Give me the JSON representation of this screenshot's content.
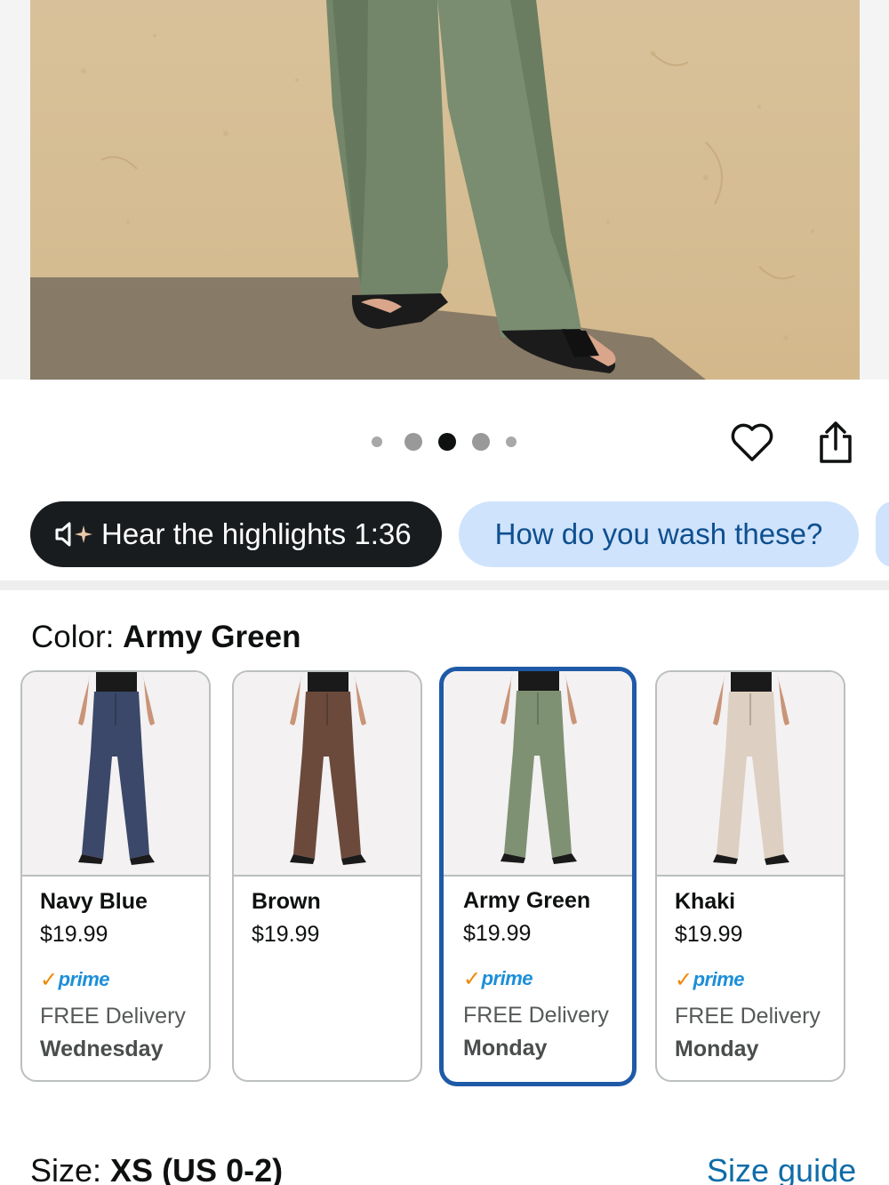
{
  "hero": {
    "image": "product-photo-model-wearing-army-green-wide-leg-pants-on-sand"
  },
  "carousel": {
    "total_dots": 5,
    "active_index": 2
  },
  "actions": {
    "favorite_icon": "heart-icon",
    "share_icon": "share-icon"
  },
  "chips": {
    "audio_label": "Hear the highlights 1:36",
    "audio_icon": "speaker-sparkle-icon",
    "question_label": "How do you wash these?"
  },
  "color": {
    "prefix": "Color: ",
    "selected": "Army Green"
  },
  "swatches": [
    {
      "name": "Navy Blue",
      "price": "$19.99",
      "prime": "prime",
      "delivery": "FREE Delivery",
      "day": "Wednesday",
      "color": "#3b4869"
    },
    {
      "name": "Brown",
      "price": "$19.99",
      "prime": "",
      "delivery": "",
      "day": "",
      "color": "#6b4a3c"
    },
    {
      "name": "Army Green",
      "price": "$19.99",
      "prime": "prime",
      "delivery": "FREE Delivery",
      "day": "Monday",
      "color": "#7f9173"
    },
    {
      "name": "Khaki",
      "price": "$19.99",
      "prime": "prime",
      "delivery": "FREE Delivery",
      "day": "Monday",
      "color": "#ddcfc2"
    }
  ],
  "size": {
    "prefix": "Size: ",
    "selected": "XS (US 0-2)",
    "guide_label": "Size guide"
  },
  "colors": {
    "accent_blue": "#1e5aa8",
    "link_blue": "#0e6ca8",
    "prime_blue": "#1c8fd8",
    "prime_check": "#f08804",
    "chip_dark": "#191c1f",
    "chip_light": "#cfe3fc"
  }
}
